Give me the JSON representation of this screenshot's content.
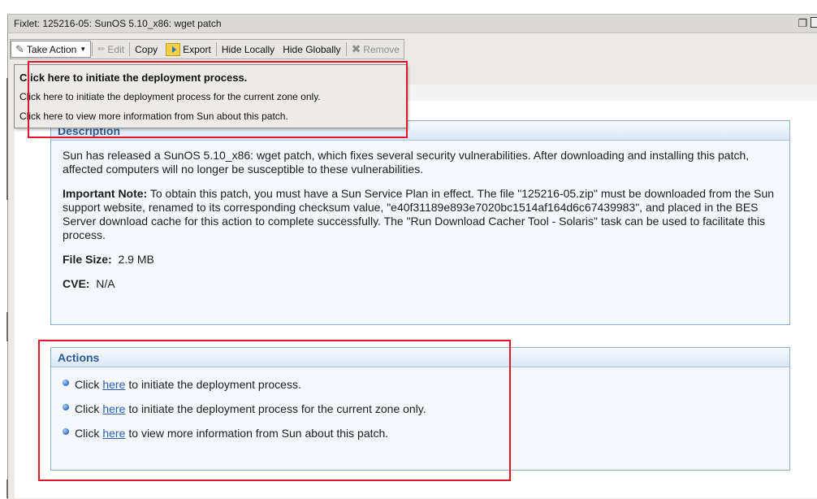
{
  "window": {
    "title": "Fixlet: 125216-05: SunOS 5.10_x86: wget patch"
  },
  "toolbar": {
    "take_action": "Take Action",
    "edit": "Edit",
    "copy": "Copy",
    "export": "Export",
    "hide_locally": "Hide Locally",
    "hide_globally": "Hide Globally",
    "remove": "Remove"
  },
  "dropdown": {
    "items": [
      "Click here to initiate the deployment process.",
      "Click here to initiate the deployment process for the current zone only.",
      "Click here to view more information from Sun about this patch."
    ]
  },
  "description": {
    "header": "Description",
    "para1": "Sun has released a SunOS 5.10_x86: wget patch, which fixes several security vulnerabilities. After downloading and installing this patch, affected computers will no longer be susceptible to these vulnerabilities.",
    "note_label": "Important Note:",
    "note_text": " To obtain this patch, you must have a Sun Service Plan in effect. The file \"125216-05.zip\" must be downloaded from the Sun support website, renamed to its corresponding checksum value, \"e40f31189e893e7020bc1514af164d6c67439983\", and placed in the BES Server download cache for this action to complete successfully. The \"Run Download Cacher Tool - Solaris\" task can be used to facilitate this process.",
    "file_size_label": "File Size:",
    "file_size_value": "2.9 MB",
    "cve_label": "CVE:",
    "cve_value": "N/A"
  },
  "actions": {
    "header": "Actions",
    "items": [
      {
        "pre": "Click",
        "link": "here",
        "post": "to initiate the deployment process."
      },
      {
        "pre": "Click",
        "link": "here",
        "post": "to initiate the deployment process for the current zone only."
      },
      {
        "pre": "Click",
        "link": "here",
        "post": "to view more information from Sun about this patch."
      }
    ]
  },
  "colors": {
    "annotation_red": "#e0192a",
    "section_header_text": "#2e5b93",
    "link_blue": "#2a5db0"
  }
}
